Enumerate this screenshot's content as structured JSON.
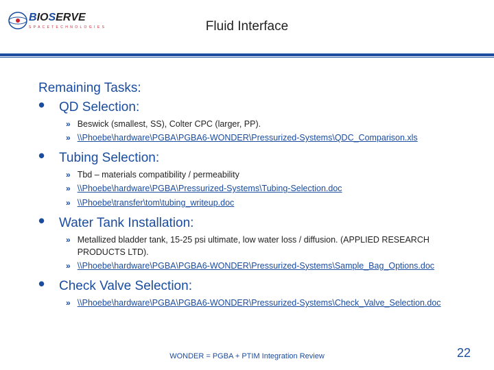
{
  "logo": {
    "brand": "BioServe",
    "tag": "S P A C E  T E C H N O L O G I E S"
  },
  "title": "Fluid Interface",
  "section_title": "Remaining Tasks:",
  "items": [
    {
      "label": "QD Selection:",
      "subs": [
        {
          "text": "Beswick (smallest, SS), Colter CPC (larger, PP).",
          "link": false
        },
        {
          "text": "\\\\Phoebe\\hardware\\PGBA\\PGBA6-WONDER\\Pressurized-Systems\\QDC_Comparison.xls",
          "link": true
        }
      ]
    },
    {
      "label": "Tubing Selection:",
      "subs": [
        {
          "text": "Tbd – materials compatibility / permeability",
          "link": false
        },
        {
          "text": "\\\\Phoebe\\hardware\\PGBA\\Pressurized-Systems\\Tubing-Selection.doc",
          "link": true
        },
        {
          "text": "\\\\Phoebe\\transfer\\tom\\tubing_writeup.doc",
          "link": true
        }
      ]
    },
    {
      "label": "Water Tank Installation:",
      "subs": [
        {
          "text": "Metallized bladder tank, 15-25 psi ultimate, low water loss / diffusion. (APPLIED RESEARCH PRODUCTS LTD).",
          "link": false
        },
        {
          "text": "\\\\Phoebe\\hardware\\PGBA\\PGBA6-WONDER\\Pressurized-Systems\\Sample_Bag_Options.doc",
          "link": true
        }
      ]
    },
    {
      "label": "Check Valve Selection:",
      "subs": [
        {
          "text": "\\\\Phoebe\\hardware\\PGBA\\PGBA6-WONDER\\Pressurized-Systems\\Check_Valve_Selection.doc",
          "link": true
        }
      ]
    }
  ],
  "footer": "WONDER  =  PGBA + PTIM Integration Review",
  "page": "22"
}
